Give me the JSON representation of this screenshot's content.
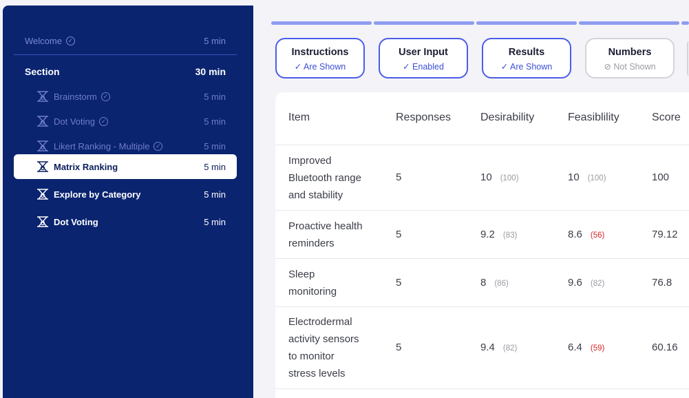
{
  "sidebar": {
    "welcome": {
      "label": "Welcome",
      "time": "5 min"
    },
    "section": {
      "label": "Section",
      "time": "30 min"
    },
    "items": [
      {
        "label": "Brainstorm",
        "time": "5 min",
        "done": true
      },
      {
        "label": "Dot Voting",
        "time": "5 min",
        "done": true
      },
      {
        "label": "Likert Ranking - Multiple",
        "time": "5 min",
        "done": true
      },
      {
        "label": "Matrix Ranking",
        "time": "5 min",
        "active": true
      },
      {
        "label": "Explore by Category",
        "time": "5 min"
      },
      {
        "label": "Dot Voting",
        "time": "5 min"
      }
    ]
  },
  "toggles": [
    {
      "title": "Instructions",
      "status": "✓ Are Shown"
    },
    {
      "title": "User Input",
      "status": "✓ Enabled"
    },
    {
      "title": "Results",
      "status": "✓ Are Shown"
    },
    {
      "title": "Numbers",
      "status": "⊘ Not Shown"
    }
  ],
  "table": {
    "headers": [
      "Item",
      "Responses",
      "Desirability",
      "Feasiblility",
      "Score"
    ],
    "rows": [
      {
        "item": [
          "Improved",
          "Bluetooth range",
          "and stability"
        ],
        "responses": "5",
        "desirability": "10",
        "desirability_sub": "(100)",
        "feasibility": "10",
        "feasibility_sub": "(100)",
        "score": "100"
      },
      {
        "item": [
          "Proactive health",
          "reminders"
        ],
        "responses": "5",
        "desirability": "9.2",
        "desirability_sub": "(83)",
        "feasibility": "8.6",
        "feasibility_sub": "(56)",
        "score": "79.12"
      },
      {
        "item": [
          "Sleep",
          "monitoring"
        ],
        "responses": "5",
        "desirability": "8",
        "desirability_sub": "(86)",
        "feasibility": "9.6",
        "feasibility_sub": "(82)",
        "score": "76.8"
      },
      {
        "item": [
          "Electrodermal",
          "activity sensors",
          "to monitor",
          "stress levels"
        ],
        "responses": "5",
        "desirability": "9.4",
        "desirability_sub": "(82)",
        "feasibility": "6.4",
        "feasibility_sub": "(59)",
        "score": "60.16"
      }
    ]
  },
  "colors": {
    "sidebar_bg": "#0a2470",
    "accent": "#4a5ce8",
    "warning": "#d8262b"
  }
}
